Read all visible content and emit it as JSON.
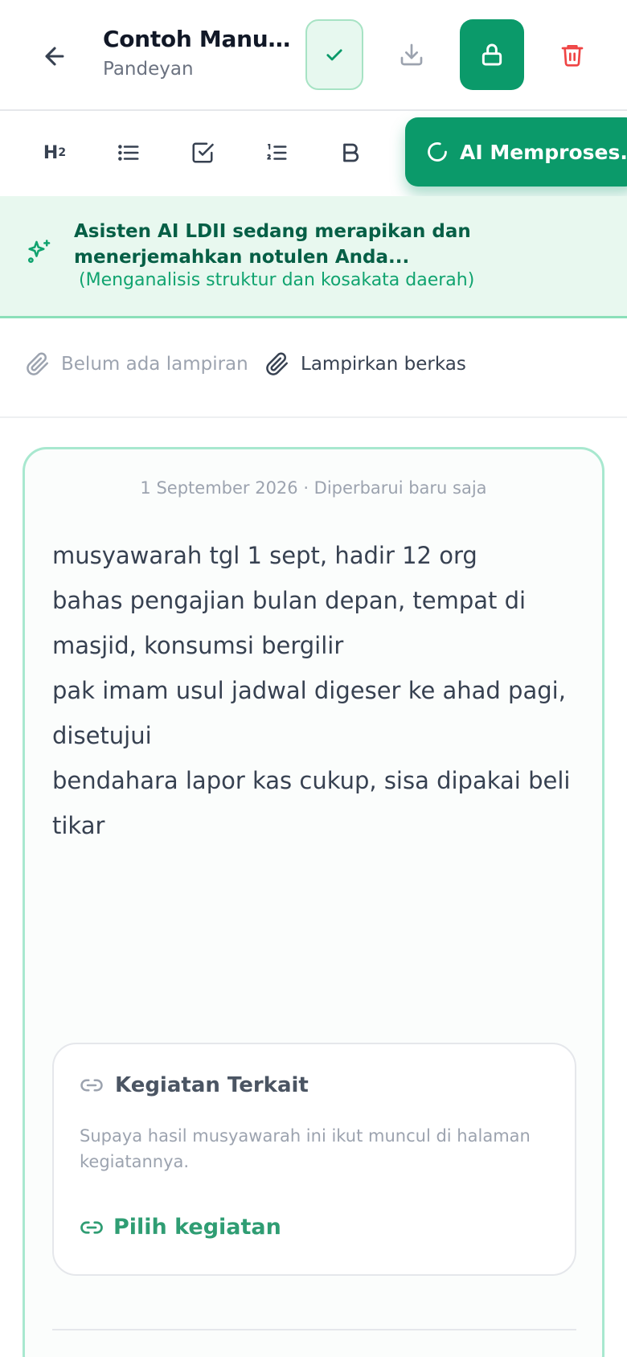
{
  "header": {
    "title": "Contoh Manual ...",
    "subtitle": "Pandeyan"
  },
  "toolbar": {
    "h2_label": "H",
    "h2_sub": "2",
    "ai_button_label": "AI Memproses..."
  },
  "banner": {
    "main": "Asisten AI LDII sedang merapikan dan menerjemahkan notulen Anda...",
    "detail": "(Menganalisis struktur dan kosakata daerah)"
  },
  "attachments": {
    "empty_label": "Belum ada lampiran",
    "attach_label": "Lampirkan berkas"
  },
  "note": {
    "date_line": "1 September 2026 · Diperbarui baru saja",
    "lines": [
      "musyawarah tgl 1 sept, hadir 12 org",
      "bahas pengajian bulan depan, tempat di masjid, konsumsi bergilir",
      "pak imam usul jadwal digeser ke ahad pagi, disetujui",
      "bendahara lapor kas cukup, sisa dipakai beli tikar"
    ]
  },
  "related": {
    "title": "Kegiatan Terkait",
    "description": "Supaya hasil musyawarah ini ikut muncul di halaman kegiatannya.",
    "pick_label": "Pilih kegiatan"
  },
  "colors": {
    "accent": "#0b9a6a",
    "accent_light": "#e8f8ef",
    "danger": "#ef4444"
  }
}
